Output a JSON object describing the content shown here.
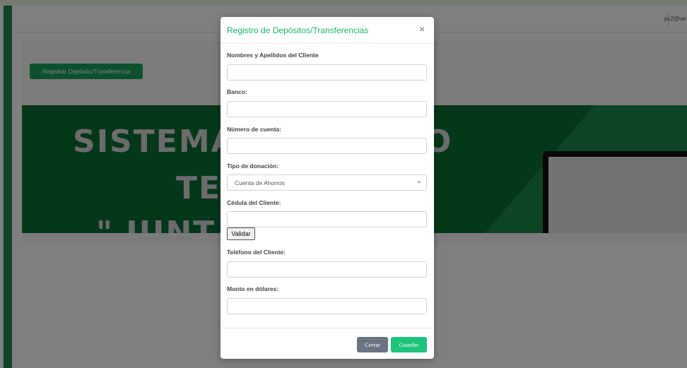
{
  "topbar": {
    "user_email": "pc2@ue"
  },
  "page": {
    "register_button_label": "Registrar Depósito/Transferencia"
  },
  "banner": {
    "line1": "SISTEMA",
    "line1b": "O",
    "line2": "TE",
    "line3": "\" JUNT"
  },
  "modal": {
    "title": "Registro de Depósitos/Transferencias",
    "close_label": "×",
    "fields": {
      "nombres_label": "Nombres y Apellidos del Cliente",
      "nombres_value": "",
      "banco_label": "Banco:",
      "banco_value": "",
      "cuenta_label": "Número de cuenta:",
      "cuenta_value": "",
      "tipo_label": "Tipo de donación:",
      "tipo_selected": "Cuenta de Ahorros",
      "cedula_label": "Cédula del Cliente:",
      "cedula_value": "",
      "validar_label": "Validar",
      "telefono_label": "Teléfono del Cliente:",
      "telefono_value": "",
      "monto_label": "Monto en dólares:",
      "monto_value": ""
    },
    "footer": {
      "cerrar_label": "Cerrar",
      "guardar_label": "Guardar"
    }
  },
  "colors": {
    "accent": "#1db36a",
    "sidebar": "#1c8b4c",
    "banner": "#0a6e35",
    "cerrar": "#6c7382",
    "guardar": "#1dc47a"
  }
}
